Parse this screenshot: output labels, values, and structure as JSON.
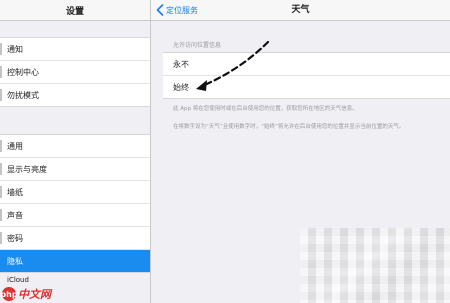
{
  "sidebar": {
    "title": "设置",
    "group1": [
      {
        "label": "通知"
      },
      {
        "label": "控制中心"
      },
      {
        "label": "勿扰模式"
      }
    ],
    "group2": [
      {
        "label": "通用"
      },
      {
        "label": "显示与亮度"
      },
      {
        "label": "墙纸"
      },
      {
        "label": "声音"
      },
      {
        "label": "密码"
      },
      {
        "label": "隐私",
        "active": true
      }
    ],
    "icloud": "iCloud"
  },
  "nav": {
    "back_label": "定位服务",
    "title": "天气"
  },
  "location_section": {
    "label": "允许访问位置信息",
    "options": [
      {
        "label": "永不"
      },
      {
        "label": "始终"
      }
    ],
    "footer_1": "此 App 将在您使用时或在后台使用您的位置，获取您所在地区的天气信息。",
    "footer_2": "在将数字设为“天气”且使用数字时，“始终”将允许在后台使用您的位置并显示当前位置的天气。"
  },
  "watermark": {
    "logo": "php",
    "text": "中文网"
  },
  "colors": {
    "accent": "#1a8cf0",
    "link": "#1a7cf0",
    "background": "#efeff4",
    "watermark": "#e03030"
  }
}
